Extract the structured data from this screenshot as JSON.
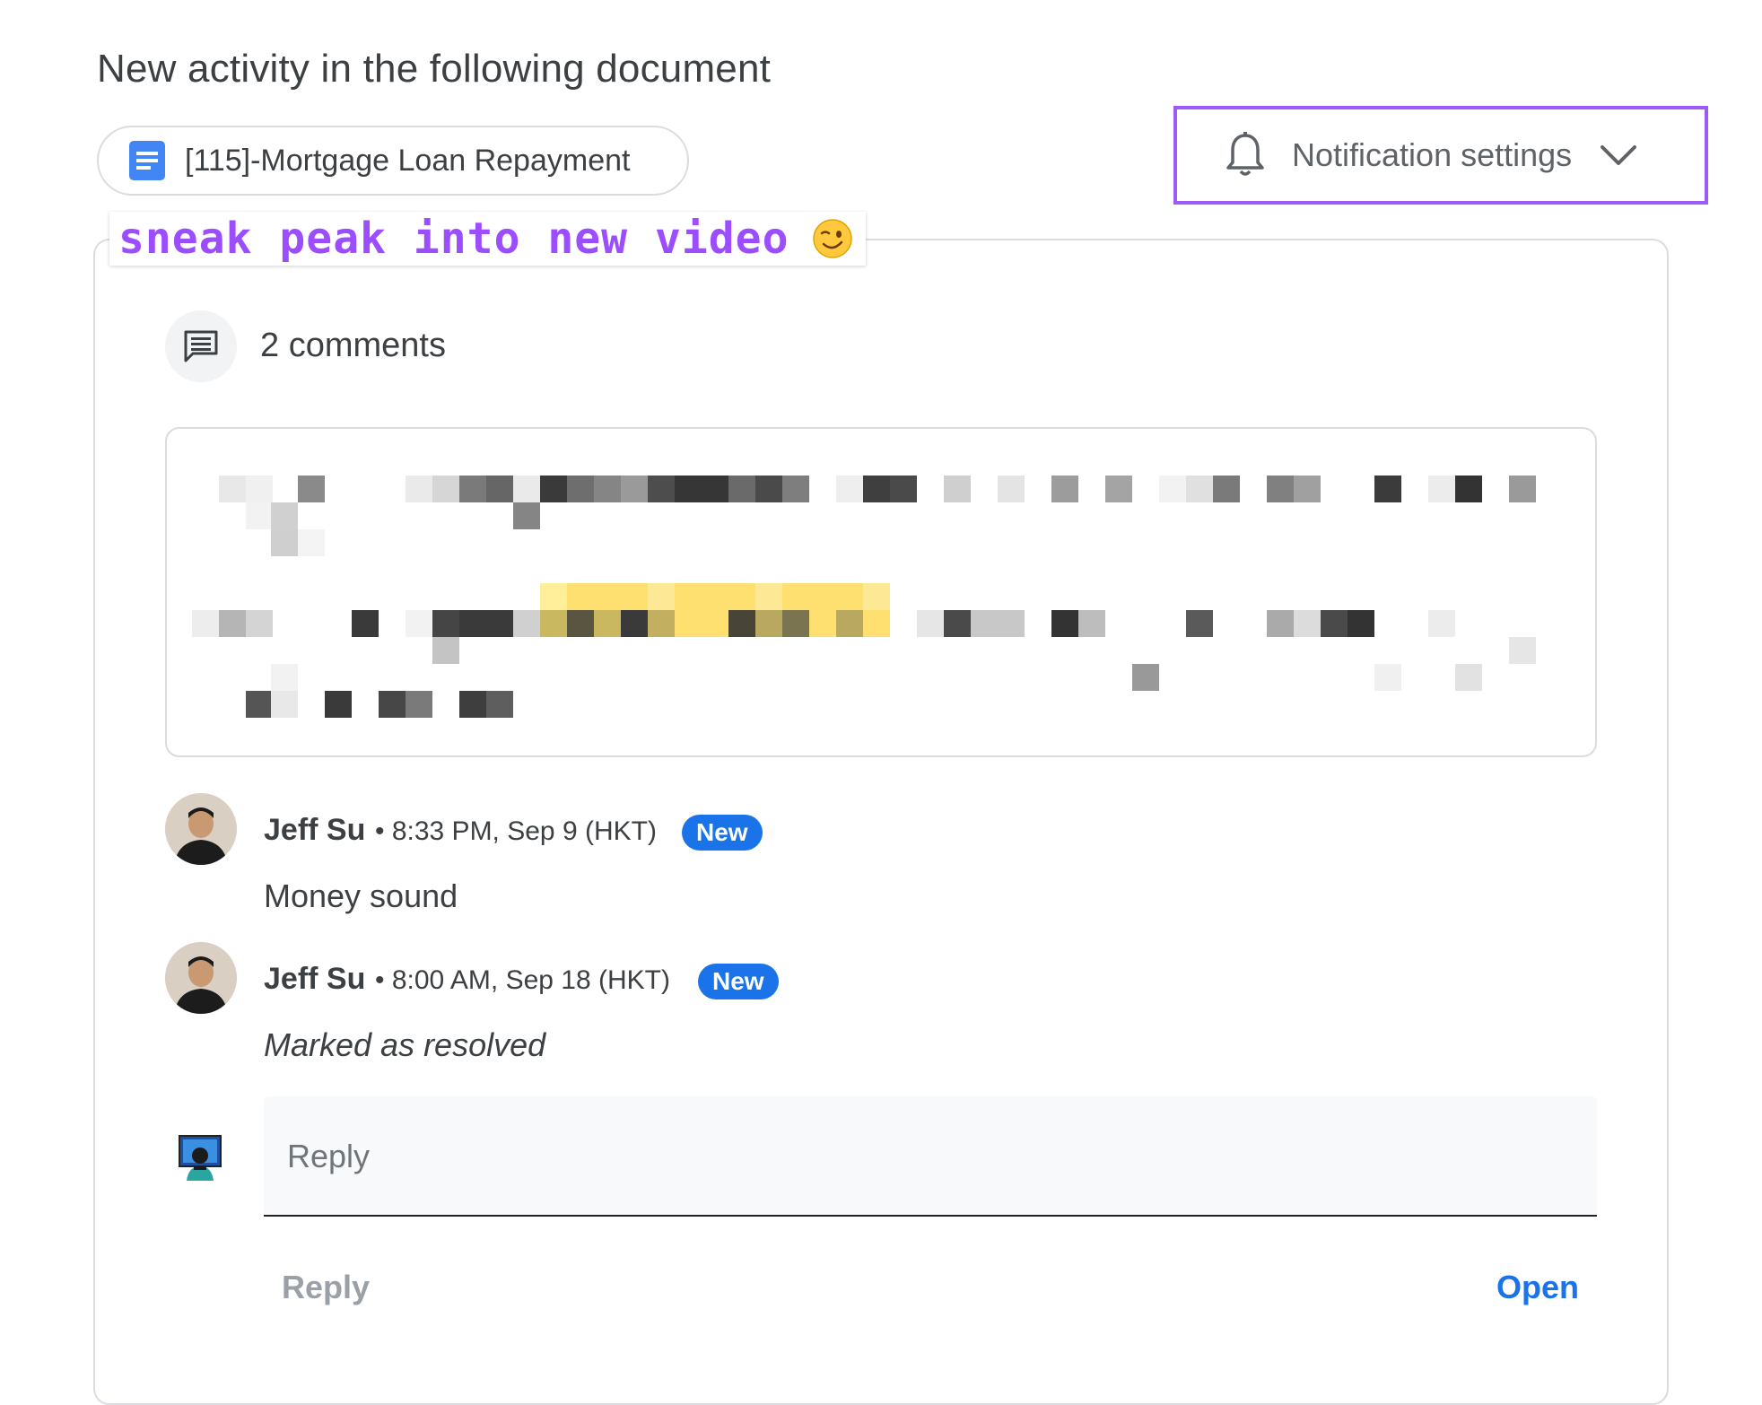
{
  "header": {
    "title": "New activity in the following document"
  },
  "document": {
    "name": "[115]-Mortgage Loan Repayment",
    "icon": "google-docs-icon",
    "icon_color": "#4285f4"
  },
  "notification": {
    "label": "Notification settings",
    "icon": "bell-icon",
    "chevron": "chevron-down-icon",
    "highlight_color": "#9b5cf6"
  },
  "overlay": {
    "caption": "sneak peak into new video",
    "emoji": "winking-face-icon",
    "color": "#9b4dff"
  },
  "thread": {
    "count_label": "2 comments",
    "icon": "comment-icon",
    "quoted_text_note": "pixelated"
  },
  "comments": [
    {
      "author": "Jeff Su",
      "time": "• 8:33 PM, Sep 9 (HKT)",
      "badge": "New",
      "body": "Money sound",
      "italic": false
    },
    {
      "author": "Jeff Su",
      "time": "• 8:00 AM, Sep 18 (HKT)",
      "badge": "New",
      "body": "Marked as resolved",
      "italic": true
    }
  ],
  "reply": {
    "placeholder": "Reply",
    "reply_button": "Reply",
    "open_button": "Open"
  },
  "colors": {
    "accent_blue": "#1a73e8",
    "border": "#dadce0",
    "text": "#3c4043"
  }
}
